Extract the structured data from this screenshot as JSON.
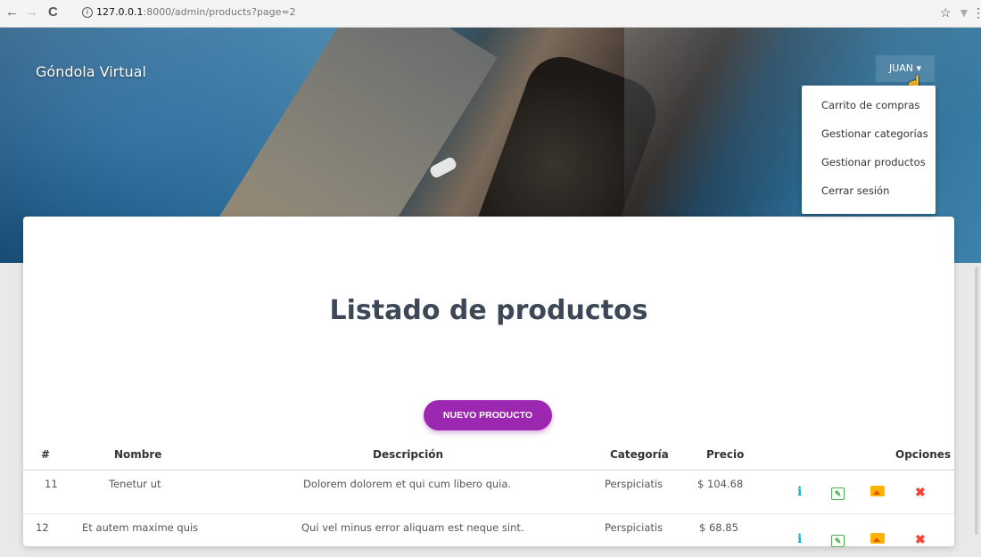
{
  "browser": {
    "back": "←",
    "forward": "→",
    "reload": "C",
    "info_icon": "i",
    "url_host": "127.0.0.1",
    "url_path": ":8000/admin/products?page=2",
    "star": "☆",
    "menu": "⋮"
  },
  "navbar": {
    "brand": "Góndola Virtual",
    "user_label": "JUAN ▾",
    "dropdown": [
      "Carrito de compras",
      "Gestionar categorías",
      "Gestionar productos",
      "Cerrar sesión"
    ]
  },
  "main": {
    "title": "Listado de productos",
    "new_button": "NUEVO PRODUCTO"
  },
  "table": {
    "headers": {
      "id": "#",
      "name": "Nombre",
      "description": "Descripción",
      "category": "Categoría",
      "price": "Precio",
      "options": "Opciones"
    },
    "rows": [
      {
        "id": "11",
        "name": "Tenetur ut",
        "description": "Dolorem dolorem et qui cum libero quia.",
        "category": "Perspiciatis",
        "price": "$ 104.68"
      },
      {
        "id": "12",
        "name": "Et autem maxime quis",
        "description": "Qui vel minus error aliquam est neque sint.",
        "category": "Perspiciatis",
        "price": "$ 68.85"
      }
    ]
  },
  "icons": {
    "info": "info-icon",
    "edit": "edit-icon",
    "image": "image-icon",
    "delete": "delete-icon"
  },
  "colors": {
    "primary_button": "#9c27b0",
    "info": "#00bcd4",
    "edit": "#4caf50",
    "image": "#ff9800",
    "delete": "#f44336",
    "title": "#3c4858"
  }
}
